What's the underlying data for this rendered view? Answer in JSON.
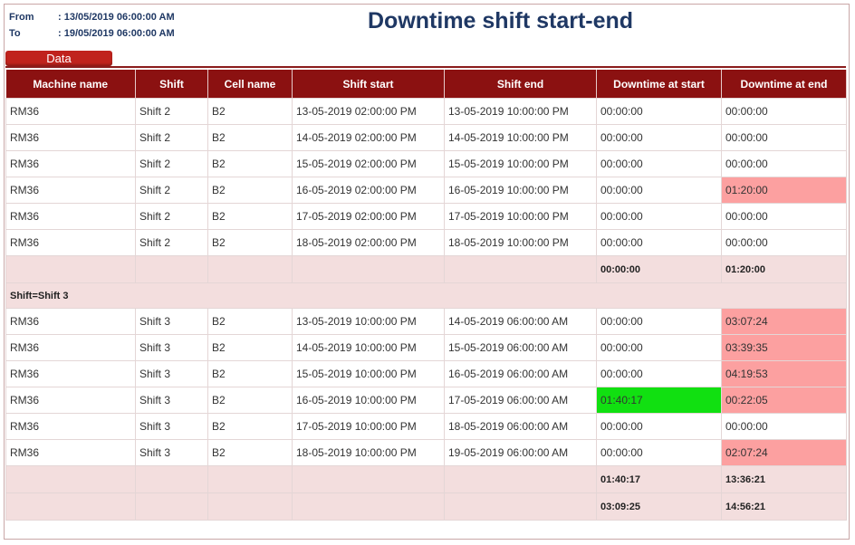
{
  "header": {
    "from_label": "From",
    "from_value": ": 13/05/2019 06:00:00 AM",
    "to_label": "To",
    "to_value": ": 19/05/2019 06:00:00 AM",
    "title": "Downtime shift start-end"
  },
  "tab": {
    "label": "Data"
  },
  "colors": {
    "header_bg": "#8b1111",
    "tab_bg": "#c0231d",
    "red_highlight": "#fca0a0",
    "green_highlight": "#11e011",
    "summary_bg": "#f3dede"
  },
  "table": {
    "columns": [
      "Machine name",
      "Shift",
      "Cell name",
      "Shift start",
      "Shift end",
      "Downtime at start",
      "Downtime at end"
    ],
    "group1_rows": [
      [
        "RM36",
        "Shift 2",
        "B2",
        "13-05-2019 02:00:00 PM",
        "13-05-2019 10:00:00 PM",
        "00:00:00",
        "00:00:00"
      ],
      [
        "RM36",
        "Shift 2",
        "B2",
        "14-05-2019 02:00:00 PM",
        "14-05-2019 10:00:00 PM",
        "00:00:00",
        "00:00:00"
      ],
      [
        "RM36",
        "Shift 2",
        "B2",
        "15-05-2019 02:00:00 PM",
        "15-05-2019 10:00:00 PM",
        "00:00:00",
        "00:00:00"
      ],
      [
        "RM36",
        "Shift 2",
        "B2",
        "16-05-2019 02:00:00 PM",
        "16-05-2019 10:00:00 PM",
        "00:00:00",
        "01:20:00"
      ],
      [
        "RM36",
        "Shift 2",
        "B2",
        "17-05-2019 02:00:00 PM",
        "17-05-2019 10:00:00 PM",
        "00:00:00",
        "00:00:00"
      ],
      [
        "RM36",
        "Shift 2",
        "B2",
        "18-05-2019 02:00:00 PM",
        "18-05-2019 10:00:00 PM",
        "00:00:00",
        "00:00:00"
      ]
    ],
    "group1_total": {
      "start": "00:00:00",
      "end": "01:20:00"
    },
    "group2_label": "Shift=Shift 3",
    "group2_rows": [
      [
        "RM36",
        "Shift 3",
        "B2",
        "13-05-2019 10:00:00 PM",
        "14-05-2019 06:00:00 AM",
        "00:00:00",
        "03:07:24"
      ],
      [
        "RM36",
        "Shift 3",
        "B2",
        "14-05-2019 10:00:00 PM",
        "15-05-2019 06:00:00 AM",
        "00:00:00",
        "03:39:35"
      ],
      [
        "RM36",
        "Shift 3",
        "B2",
        "15-05-2019 10:00:00 PM",
        "16-05-2019 06:00:00 AM",
        "00:00:00",
        "04:19:53"
      ],
      [
        "RM36",
        "Shift 3",
        "B2",
        "16-05-2019 10:00:00 PM",
        "17-05-2019 06:00:00 AM",
        "01:40:17",
        "00:22:05"
      ],
      [
        "RM36",
        "Shift 3",
        "B2",
        "17-05-2019 10:00:00 PM",
        "18-05-2019 06:00:00 AM",
        "00:00:00",
        "00:00:00"
      ],
      [
        "RM36",
        "Shift 3",
        "B2",
        "18-05-2019 10:00:00 PM",
        "19-05-2019 06:00:00 AM",
        "00:00:00",
        "02:07:24"
      ]
    ],
    "group2_total": {
      "start": "01:40:17",
      "end": "13:36:21"
    },
    "grand_total": {
      "start": "03:09:25",
      "end": "14:56:21"
    }
  }
}
